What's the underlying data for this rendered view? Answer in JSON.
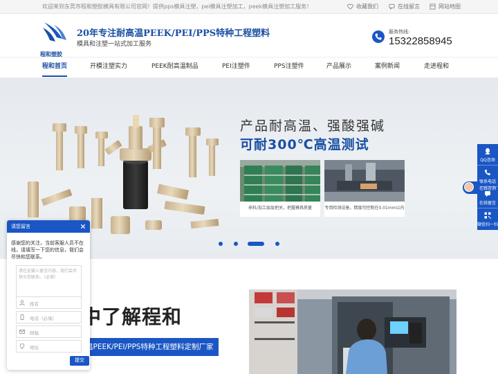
{
  "topbar": {
    "welcome": "欢迎来到东莞市程和塑胶模具有限公司官网！提供pps模具注塑，pei模具注塑加工，peek模具注塑加工服务！",
    "links": [
      "收藏我们",
      "在线留言",
      "网站地图"
    ]
  },
  "header": {
    "logo_text": "程和塑胶",
    "slogan": "20年专注耐高温PEEK/PEI/PPS特种工程塑料",
    "sub_slogan": "模具和注塑一站式加工服务",
    "phone_label": "服务热线:",
    "phone_number": "15322858945"
  },
  "nav": {
    "items": [
      "程和首页",
      "开模注塑实力",
      "PEEK耐高温制品",
      "PEI注塑件",
      "PPS注塑件",
      "产品展示",
      "案例新闻",
      "走进程和"
    ],
    "active": "程和首页"
  },
  "banner": {
    "title_line1": "产品耐高温、强酸强碱",
    "title_line2": "可耐300℃高温测试",
    "cards": [
      {
        "caption": "来料/加工层层把关，把握模具质量"
      },
      {
        "caption": "专用检测设备，精度可控制在0.01mm以内"
      }
    ],
    "slide_count": 4,
    "active_slide": 3
  },
  "about": {
    "title": "中了解程和",
    "subtitle": "温PEEK/PEI/PPS特种工程塑料定制厂家"
  },
  "chat": {
    "header": "请您留言",
    "message": "感谢您的关注，当前客服人员不在线，请填写一下您的信息，我们会尽快和您联系。",
    "textarea_placeholder": "请在此输入留言内容，我们会尽快与您联系。（必填）",
    "fields": [
      "姓名",
      "电话（必填）",
      "邮箱",
      "地址"
    ],
    "submit": "提交"
  },
  "floatbar": {
    "items": [
      "QQ咨询",
      "联系电话",
      "在线留言",
      "微信扫一扫"
    ],
    "popout": "在线咨询"
  },
  "colors": {
    "brand_blue": "#1a56c4",
    "title_blue": "#1a4fa3"
  },
  "icons": [
    "heart-icon",
    "chat-icon",
    "sitemap-icon",
    "phone-icon",
    "close-icon",
    "user-icon",
    "mobile-icon",
    "email-icon",
    "location-icon",
    "qq-icon",
    "message-icon",
    "qr-code-icon"
  ]
}
